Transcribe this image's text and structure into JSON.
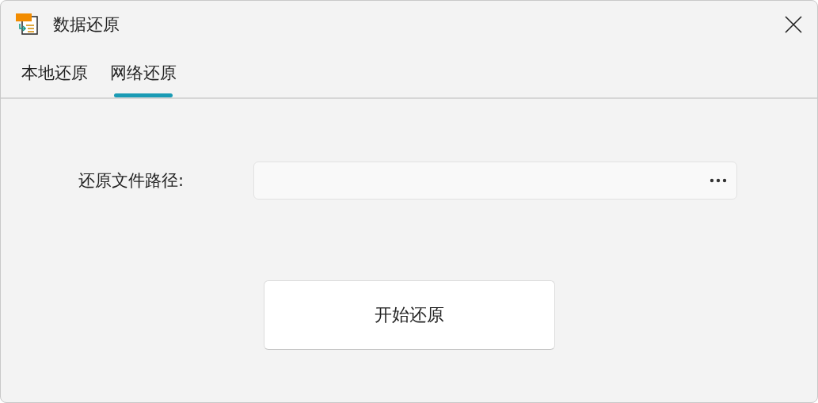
{
  "window": {
    "title": "数据还原"
  },
  "tabs": [
    {
      "label": "本地还原",
      "selected": false
    },
    {
      "label": "网络还原",
      "selected": true
    }
  ],
  "form": {
    "label": "还原文件路径:"
  },
  "buttons": [
    {
      "label": "开始还原"
    }
  ]
}
